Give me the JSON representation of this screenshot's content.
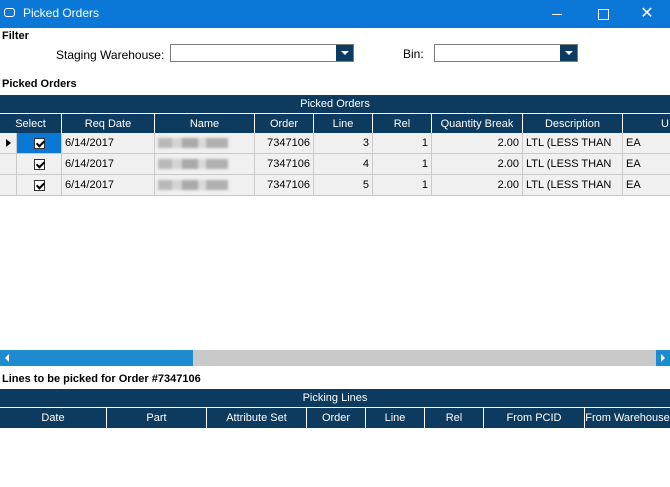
{
  "window": {
    "title": "Picked Orders",
    "minimize": "—",
    "maximize": "☐",
    "close": "✕"
  },
  "filter": {
    "section_label": "Filter",
    "staging_warehouse_label": "Staging Warehouse:",
    "staging_warehouse_value": "",
    "bin_label": "Bin:",
    "bin_value": ""
  },
  "picked_orders": {
    "section_label": "Picked Orders",
    "band_label": "Picked Orders",
    "columns": [
      "Select",
      "Req Date",
      "Name",
      "Order",
      "Line",
      "Rel",
      "Quantity Break",
      "Description",
      "U"
    ],
    "rows": [
      {
        "selected": true,
        "req_date": "6/14/2017",
        "name": "",
        "order": "7347106",
        "line": "3",
        "rel": "1",
        "quantity_break": "2.00",
        "description": "LTL (LESS THAN",
        "uom": "EA"
      },
      {
        "selected": true,
        "req_date": "6/14/2017",
        "name": "",
        "order": "7347106",
        "line": "4",
        "rel": "1",
        "quantity_break": "2.00",
        "description": "LTL (LESS THAN",
        "uom": "EA"
      },
      {
        "selected": true,
        "req_date": "6/14/2017",
        "name": "",
        "order": "7347106",
        "line": "5",
        "rel": "1",
        "quantity_break": "2.00",
        "description": "LTL (LESS THAN",
        "uom": "EA"
      }
    ]
  },
  "lines_to_pick": {
    "section_label": "Lines to be picked for Order #7347106",
    "band_label": "Picking Lines",
    "columns": [
      "Date",
      "Part",
      "Attribute Set",
      "Order",
      "Line",
      "Rel",
      "From PCID",
      "From Warehouse"
    ]
  },
  "colors": {
    "titlebar": "#0b78d7",
    "header": "#0d3a5f",
    "scroll": "#1e8bd0",
    "selected_cell": "#0b78d7"
  }
}
